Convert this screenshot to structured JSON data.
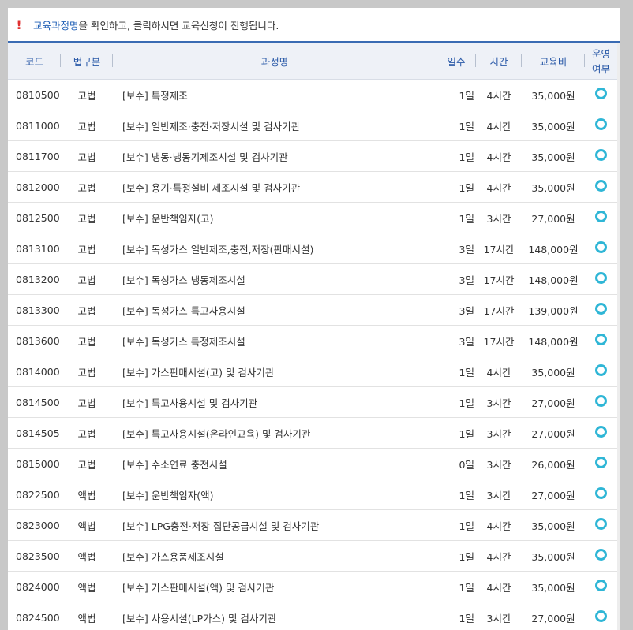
{
  "notice": {
    "icon": "exclamation-icon",
    "highlight": "교육과정명",
    "text": "을 확인하고, 클릭하시면 교육신청이 진행됩니다."
  },
  "table": {
    "headers": {
      "code": "코드",
      "law": "법구분",
      "course": "과정명",
      "days": "일수",
      "hours": "시간",
      "fee": "교육비",
      "status_line1": "운영",
      "status_line2": "여부"
    },
    "rows": [
      {
        "code": "0810500",
        "law": "고법",
        "course": "[보수] 특정제조",
        "days": "1일",
        "hours": "4시간",
        "fee": "35,000원"
      },
      {
        "code": "0811000",
        "law": "고법",
        "course": "[보수] 일반제조·충전·저장시설 및 검사기관",
        "days": "1일",
        "hours": "4시간",
        "fee": "35,000원"
      },
      {
        "code": "0811700",
        "law": "고법",
        "course": "[보수] 냉동·냉동기제조시설 및 검사기관",
        "days": "1일",
        "hours": "4시간",
        "fee": "35,000원"
      },
      {
        "code": "0812000",
        "law": "고법",
        "course": "[보수] 용기·특정설비 제조시설 및 검사기관",
        "days": "1일",
        "hours": "4시간",
        "fee": "35,000원"
      },
      {
        "code": "0812500",
        "law": "고법",
        "course": "[보수] 운반책임자(고)",
        "days": "1일",
        "hours": "3시간",
        "fee": "27,000원"
      },
      {
        "code": "0813100",
        "law": "고법",
        "course": "[보수] 독성가스 일반제조,충전,저장(판매시설)",
        "days": "3일",
        "hours": "17시간",
        "fee": "148,000원"
      },
      {
        "code": "0813200",
        "law": "고법",
        "course": "[보수] 독성가스 냉동제조시설",
        "days": "3일",
        "hours": "17시간",
        "fee": "148,000원"
      },
      {
        "code": "0813300",
        "law": "고법",
        "course": "[보수] 독성가스 특고사용시설",
        "days": "3일",
        "hours": "17시간",
        "fee": "139,000원"
      },
      {
        "code": "0813600",
        "law": "고법",
        "course": "[보수] 독성가스 특정제조시설",
        "days": "3일",
        "hours": "17시간",
        "fee": "148,000원"
      },
      {
        "code": "0814000",
        "law": "고법",
        "course": "[보수] 가스판매시설(고) 및 검사기관",
        "days": "1일",
        "hours": "4시간",
        "fee": "35,000원"
      },
      {
        "code": "0814500",
        "law": "고법",
        "course": "[보수] 특고사용시설 및 검사기관",
        "days": "1일",
        "hours": "3시간",
        "fee": "27,000원"
      },
      {
        "code": "0814505",
        "law": "고법",
        "course": "[보수] 특고사용시설(온라인교육) 및 검사기관",
        "days": "1일",
        "hours": "3시간",
        "fee": "27,000원"
      },
      {
        "code": "0815000",
        "law": "고법",
        "course": "[보수] 수소연료 충전시설",
        "days": "0일",
        "hours": "3시간",
        "fee": "26,000원"
      },
      {
        "code": "0822500",
        "law": "액법",
        "course": "[보수] 운반책임자(액)",
        "days": "1일",
        "hours": "3시간",
        "fee": "27,000원"
      },
      {
        "code": "0823000",
        "law": "액법",
        "course": "[보수] LPG충전·저장 집단공급시설 및 검사기관",
        "days": "1일",
        "hours": "4시간",
        "fee": "35,000원"
      },
      {
        "code": "0823500",
        "law": "액법",
        "course": "[보수] 가스용품제조시설",
        "days": "1일",
        "hours": "4시간",
        "fee": "35,000원"
      },
      {
        "code": "0824000",
        "law": "액법",
        "course": "[보수] 가스판매시설(액) 및 검사기관",
        "days": "1일",
        "hours": "4시간",
        "fee": "35,000원"
      },
      {
        "code": "0824500",
        "law": "액법",
        "course": "[보수] 사용시설(LP가스) 및 검사기관",
        "days": "1일",
        "hours": "3시간",
        "fee": "27,000원"
      }
    ],
    "status_icon": "circle-status-icon",
    "status_color": "#2fb6d6"
  }
}
